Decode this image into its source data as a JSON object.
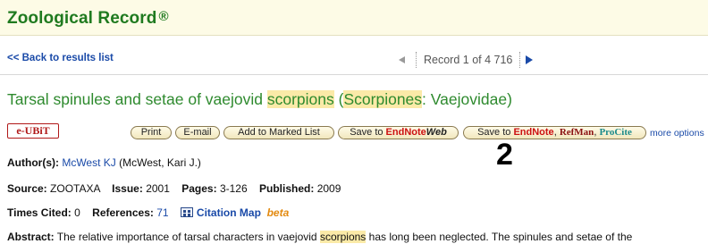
{
  "header": {
    "title": "Zoological Record",
    "reg": "®"
  },
  "nav": {
    "back_label": "<< Back to results list",
    "record_text": "Record 1  of  4 716"
  },
  "record": {
    "title_part1": "Tarsal spinules and setae of vaejovid ",
    "title_hl1": "scorpions",
    "title_part2": " (",
    "title_hl2": "Scorpiones",
    "title_part3": ": Vaejovidae)"
  },
  "actions": {
    "eubit": "e-UBiT",
    "print": "Print",
    "email": "E-mail",
    "add_marked": "Add to Marked List",
    "save_endnote_web_prefix": "Save to ",
    "save_endnote_web_brand": "EndNote",
    "save_endnote_web_suffix": "Web",
    "save_endnote_prefix": "Save to ",
    "save_endnote_brand": "EndNote",
    "save_refman": "RefMan",
    "save_procite": "ProCite",
    "more_options": "more options"
  },
  "annotation_number": "2",
  "fields": {
    "authors_label": "Author(s):",
    "authors_link": "McWest KJ",
    "authors_full": " (McWest, Kari J.)",
    "source_label": "Source:",
    "source_value": "ZOOTAXA",
    "issue_label": "Issue:",
    "issue_value": "2001",
    "pages_label": "Pages:",
    "pages_value": "3-126",
    "published_label": "Published:",
    "published_value": "2009",
    "times_cited_label": "Times Cited:",
    "times_cited_value": "0",
    "references_label": "References:",
    "references_value": "71",
    "citation_map": "Citation Map",
    "beta": "beta",
    "abstract_label": "Abstract:",
    "abstract_part1": " The relative importance of tarsal characters in vaejovid ",
    "abstract_hl": "scorpions",
    "abstract_part2": " has long been neglected. The spinules and setae of the"
  }
}
